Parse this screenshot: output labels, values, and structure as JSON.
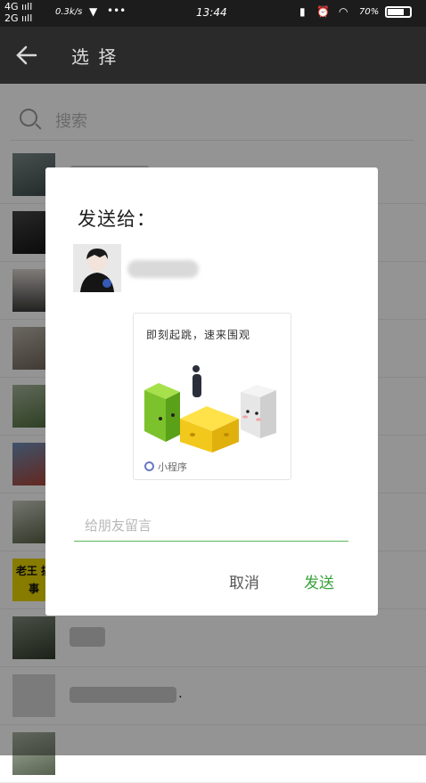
{
  "status_bar": {
    "net1": "4G ııll",
    "net2": "2G ııll",
    "speed": "0.3k/s",
    "dots": "•••",
    "time": "13:44",
    "battery_text": "70%",
    "battery_level": 0.7
  },
  "nav": {
    "title": "选 择"
  },
  "search": {
    "placeholder": "搜索"
  },
  "list_rows": [
    {
      "name": ""
    },
    {
      "name": ""
    },
    {
      "name": ""
    },
    {
      "name": ""
    },
    {
      "name": ""
    },
    {
      "name": ""
    },
    {
      "name": ""
    },
    {
      "name": "",
      "badge": "老王 搞事"
    },
    {
      "name": ""
    },
    {
      "name": "."
    }
  ],
  "dialog": {
    "title": "发送给：",
    "recipient_name": "",
    "card": {
      "title": "即刻起跳，速来围观",
      "footer": "小程序"
    },
    "message_placeholder": "给朋友留言",
    "cancel_label": "取消",
    "send_label": "发送"
  },
  "colors": {
    "accent_green": "#39a23a",
    "navbar": "#2a2a2a",
    "statusbar": "#1c1c1c"
  }
}
